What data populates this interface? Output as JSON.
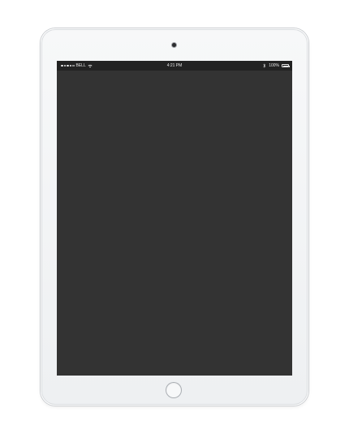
{
  "status_bar": {
    "carrier": "BELL",
    "time": "4:21 PM",
    "battery": "100%",
    "signal_bars_filled": 4,
    "signal_bars_total": 5,
    "icons": [
      "signal-dots-icon",
      "wifi-icon",
      "bluetooth-icon",
      "battery-icon"
    ]
  },
  "screen": {
    "background": "#333333",
    "status_bar_background": "#222222"
  },
  "device": {
    "color": "silver",
    "body_color": "#f2f3f4"
  }
}
